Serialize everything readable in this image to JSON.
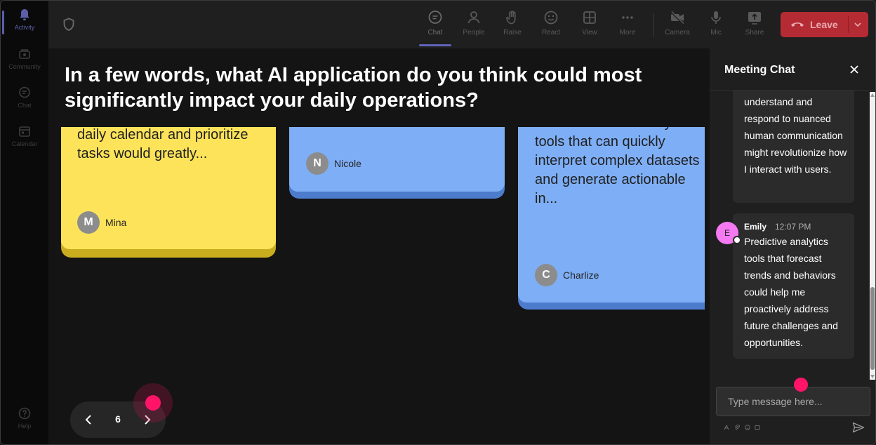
{
  "rail": {
    "items": [
      {
        "label": "Activity",
        "icon": "bell-icon"
      },
      {
        "label": "Community",
        "icon": "community-icon"
      },
      {
        "label": "Chat",
        "icon": "chat-icon"
      },
      {
        "label": "Calendar",
        "icon": "calendar-icon"
      }
    ],
    "help": "Help"
  },
  "toolbar": {
    "chat": "Chat",
    "people": "People",
    "raise": "Raise",
    "react": "React",
    "view": "View",
    "more": "More",
    "camera": "Camera",
    "mic": "Mic",
    "share": "Share",
    "leave": "Leave"
  },
  "stage": {
    "question": "In a few words, what AI application do you think could most significantly impact your daily operations?",
    "cards": [
      {
        "color": "#fde35a",
        "shadow": "#c9ad1e",
        "text": "daily calendar and prioritize tasks would greatly...",
        "author": "Mina",
        "initial": "M"
      },
      {
        "color": "#7eaef5",
        "shadow": "#4d7ccc",
        "text": "",
        "author": "Nicole",
        "initial": "N"
      },
      {
        "color": "#7eaef5",
        "shadow": "#4d7ccc",
        "text": "Automated data analysis tools that can quickly interpret complex datasets and generate actionable in...",
        "author": "Charlize",
        "initial": "C"
      }
    ],
    "page": "6"
  },
  "chat": {
    "title": "Meeting Chat",
    "messages": [
      {
        "text": "understand and respond to nuanced human communication might revolutionize how I interact with users."
      },
      {
        "name": "Emily",
        "time": "12:07 PM",
        "initial": "E",
        "text": "Predictive analytics tools that forecast trends and behaviors could help me proactively address future challenges and opportunities."
      }
    ],
    "placeholder": "Type message here..."
  },
  "colors": {
    "accent": "#5f63b8",
    "leave": "#b52b34",
    "cursor": "#ff1468"
  }
}
